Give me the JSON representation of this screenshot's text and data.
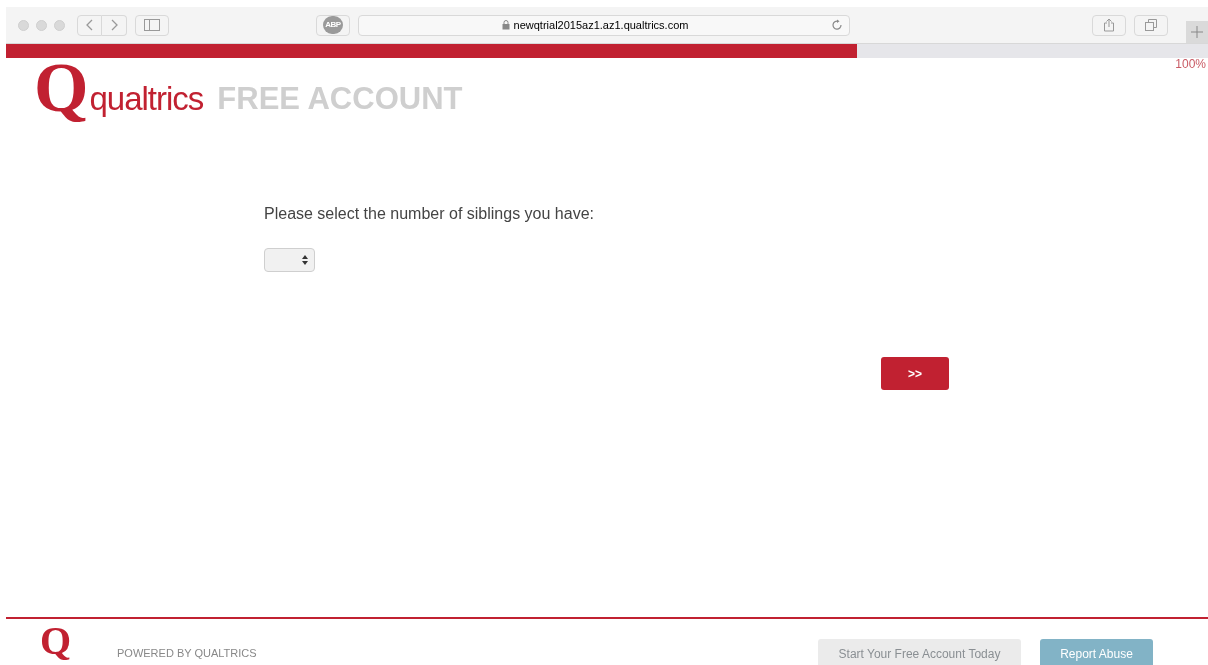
{
  "browser": {
    "url": "newqtrial2015az1.az1.qualtrics.com",
    "adblock_label": "ABP"
  },
  "progress": {
    "level": 0.708,
    "reading": "100%"
  },
  "header": {
    "logo_letter": "Q",
    "logo_word": "qualtrics",
    "tagline": "FREE ACCOUNT"
  },
  "question": {
    "text": "Please select the number of siblings you have:"
  },
  "next_button": {
    "label": ">>"
  },
  "footer": {
    "logo_letter": "Q",
    "powered_by": "POWERED BY QUALTRICS",
    "buttons": [
      {
        "label": "Start Your Free Account Today",
        "kind": "secondary"
      },
      {
        "label": "Report Abuse",
        "kind": "primary"
      }
    ]
  }
}
